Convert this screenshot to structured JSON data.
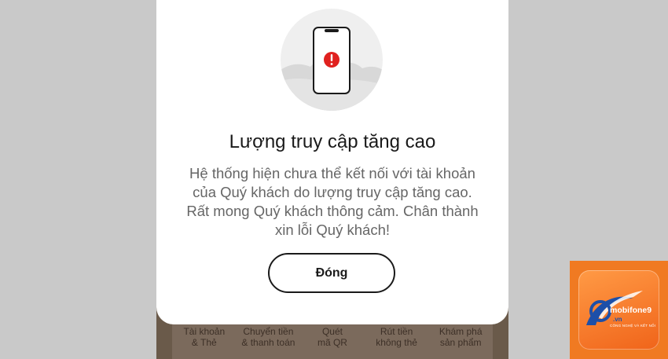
{
  "modal": {
    "title": "Lượng truy cập tăng cao",
    "message": "Hệ thống hiện chưa thể kết nối với tài khoản của Quý khách do lượng truy cập tăng cao. Rất mong Quý khách thông cảm. Chân thành xin lỗi Quý khách!",
    "close_label": "Đóng",
    "illustration_icon": "phone-error-icon"
  },
  "bottom_nav": {
    "items": [
      {
        "label": "Tài khoản\n& Thẻ"
      },
      {
        "label": "Chuyển tiền\n& thanh toán"
      },
      {
        "label": "Quét\nmã QR"
      },
      {
        "label": "Rút tiền\nkhông thẻ"
      },
      {
        "label": "Khám phá\nsản phẩm"
      }
    ]
  },
  "watermark": {
    "brand": "mobifone9",
    "domain": ".vn",
    "tagline": "CÔNG NGHỆ VÀ KẾT NỐI"
  },
  "colors": {
    "page_bg": "#c9c9c9",
    "modal_bg": "#ffffff",
    "error_red": "#e0211f",
    "badge_orange": "#f07a22"
  }
}
